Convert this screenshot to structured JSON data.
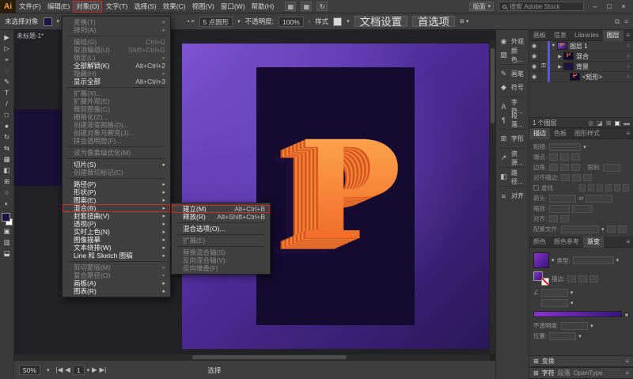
{
  "titlebar": {
    "logo": "Ai",
    "menus": [
      "文件(F)",
      "编辑(E)",
      "对象(O)",
      "文字(T)",
      "选择(S)",
      "效果(C)",
      "视图(V)",
      "窗口(W)",
      "帮助(H)"
    ],
    "active_menu_index": 2,
    "icons": [
      {
        "name": "arrange-documents-icon",
        "glyph": "▦"
      },
      {
        "name": "workspace-switcher-icon",
        "glyph": "▦"
      },
      {
        "name": "share-icon",
        "glyph": "↻"
      }
    ],
    "workspace_label": "版面",
    "search_placeholder": "搜索 Adobe Stock",
    "window_controls": {
      "minimize": "–",
      "maximize": "□",
      "close": "×"
    }
  },
  "control_bar": {
    "no_selection_label": "未选择对象",
    "brush_value": "5 点圆形",
    "opacity_label": "不透明度:",
    "opacity_value": "100%",
    "style_label": "样式",
    "document_setup_label": "文档设置",
    "preferences_label": "首选项"
  },
  "document_tab": "未标题-1*",
  "object_menu": {
    "items": [
      {
        "label": "变换(T)",
        "arrow": true,
        "enabled": false
      },
      {
        "label": "排列(A)",
        "arrow": true,
        "enabled": false
      },
      {
        "type": "sep"
      },
      {
        "label": "编组(G)",
        "shortcut": "Ctrl+G",
        "enabled": false
      },
      {
        "label": "取消编组(U)",
        "shortcut": "Shift+Ctrl+G",
        "enabled": false
      },
      {
        "label": "锁定(L)",
        "arrow": true,
        "enabled": false
      },
      {
        "label": "全部解锁(K)",
        "shortcut": "Alt+Ctrl+2",
        "enabled": true
      },
      {
        "label": "隐藏(H)",
        "arrow": true,
        "enabled": false
      },
      {
        "label": "显示全部",
        "shortcut": "Alt+Ctrl+3",
        "enabled": true
      },
      {
        "type": "sep"
      },
      {
        "label": "扩展(X)...",
        "enabled": false
      },
      {
        "label": "扩展外观(E)",
        "enabled": false
      },
      {
        "label": "裁剪图像(C)",
        "enabled": false
      },
      {
        "label": "栅格化(Z)...",
        "enabled": false
      },
      {
        "label": "创建渐变网格(D)...",
        "enabled": false
      },
      {
        "label": "创建对象马赛克(J)...",
        "enabled": false
      },
      {
        "label": "拼合透明度(F)...",
        "enabled": false
      },
      {
        "type": "sep"
      },
      {
        "label": "设为像素级优化(M)",
        "enabled": false
      },
      {
        "type": "sep"
      },
      {
        "label": "切片(S)",
        "arrow": true,
        "enabled": true
      },
      {
        "label": "创建裁切标记(C)",
        "enabled": false
      },
      {
        "type": "sep"
      },
      {
        "label": "路径(P)",
        "arrow": true,
        "enabled": true
      },
      {
        "label": "形状(P)",
        "arrow": true,
        "enabled": true
      },
      {
        "label": "图案(E)",
        "arrow": true,
        "enabled": true
      },
      {
        "label": "混合(B)",
        "arrow": true,
        "enabled": true,
        "annotated": true
      },
      {
        "label": "封套扭曲(V)",
        "arrow": true,
        "enabled": true
      },
      {
        "label": "透视(P)",
        "arrow": true,
        "enabled": true
      },
      {
        "label": "实时上色(N)",
        "arrow": true,
        "enabled": true
      },
      {
        "label": "图像描摹",
        "arrow": true,
        "enabled": true
      },
      {
        "label": "文本绕排(W)",
        "arrow": true,
        "enabled": true
      },
      {
        "label": "Line 和 Sketch 图稿",
        "arrow": true,
        "enabled": true
      },
      {
        "type": "sep"
      },
      {
        "label": "剪切蒙版(M)",
        "arrow": true,
        "enabled": false
      },
      {
        "label": "复合路径(O)",
        "arrow": true,
        "enabled": false
      },
      {
        "label": "画板(A)",
        "arrow": true,
        "enabled": true
      },
      {
        "label": "图表(R)",
        "arrow": true,
        "enabled": true
      }
    ]
  },
  "blend_submenu": {
    "items": [
      {
        "label": "建立(M)",
        "shortcut": "Alt+Ctrl+B",
        "enabled": true,
        "annotated": true
      },
      {
        "label": "释放(R)",
        "shortcut": "Alt+Shift+Ctrl+B",
        "enabled": true
      },
      {
        "type": "sep"
      },
      {
        "label": "混合选项(O)...",
        "enabled": true
      },
      {
        "type": "sep"
      },
      {
        "label": "扩展(E)",
        "enabled": false
      },
      {
        "type": "sep"
      },
      {
        "label": "替换混合轴(S)",
        "enabled": false
      },
      {
        "label": "反向混合轴(V)",
        "enabled": false
      },
      {
        "label": "反向堆叠(F)",
        "enabled": false
      }
    ]
  },
  "toolbar": {
    "tools": [
      {
        "name": "selection-tool",
        "glyph": "▶"
      },
      {
        "name": "direct-selection-tool",
        "glyph": "▷"
      },
      {
        "name": "magic-wand-tool",
        "glyph": "⌖"
      },
      {
        "name": "lasso-tool",
        "glyph": "◌"
      },
      {
        "name": "pen-tool",
        "glyph": "✎"
      },
      {
        "name": "type-tool",
        "glyph": "T"
      },
      {
        "name": "line-segment-tool",
        "glyph": "/"
      },
      {
        "name": "rectangle-tool",
        "glyph": "□"
      },
      {
        "name": "paintbrush-tool",
        "glyph": "●"
      },
      {
        "name": "rotate-tool",
        "glyph": "↻"
      },
      {
        "name": "width-tool",
        "glyph": "⇆"
      },
      {
        "name": "mesh-tool",
        "glyph": "▦"
      },
      {
        "name": "gradient-tool",
        "glyph": "◧"
      },
      {
        "name": "blend-tool",
        "glyph": "⊞"
      },
      {
        "name": "hand-tool",
        "glyph": "○"
      },
      {
        "name": "zoom-tool",
        "glyph": "◐"
      }
    ],
    "fill_color": "#1e1444",
    "mode_icons": [
      {
        "name": "draw-normal-icon",
        "glyph": "▣"
      },
      {
        "name": "draw-behind-icon",
        "glyph": "▥"
      },
      {
        "name": "screen-mode-icon",
        "glyph": "⬓"
      }
    ]
  },
  "canvas": {
    "letter": "P",
    "colors": {
      "artboard_light": "#7f54d6",
      "artboard_dark": "#2a1758",
      "poster": "#150b30",
      "letter_top": "#ffb254",
      "letter_bottom": "#ef5a1e",
      "letter_side_a": "#d4541c",
      "letter_side_b": "#f08438",
      "letter_shadow": "#1a0d38",
      "annotation_red": "#c9302c"
    }
  },
  "status_bar": {
    "zoom_value": "50%",
    "first_label": "|◀",
    "prev_label": "◀",
    "artboard_value": "1",
    "next_label": "▶",
    "last_label": "▶|",
    "tool_label": "选择"
  },
  "icon_strip": [
    {
      "name": "appearance-icon",
      "glyph": "◉",
      "label": "外观",
      "sep_after": false
    },
    {
      "name": "color-guide-icon",
      "glyph": "▧",
      "label": "颜色...",
      "sep_after": true
    },
    {
      "name": "brushes-icon",
      "glyph": "✎",
      "label": "画笔",
      "sep_after": false
    },
    {
      "name": "symbols-icon",
      "glyph": "◆",
      "label": "符号",
      "sep_after": true
    },
    {
      "name": "character-styles-icon",
      "glyph": "A",
      "label": "字符...",
      "sep_after": false
    },
    {
      "name": "paragraph-styles-icon",
      "glyph": "¶",
      "label": "段落...",
      "sep_after": true
    },
    {
      "name": "glyphs-icon",
      "glyph": "⊞",
      "label": "字形",
      "sep_after": true
    },
    {
      "name": "asset-export-icon",
      "glyph": "↗",
      "label": "资源...",
      "sep_after": true
    },
    {
      "name": "pathfinder-icon",
      "glyph": "◧",
      "label": "路径...",
      "sep_after": true
    },
    {
      "name": "align-icon",
      "glyph": "≡",
      "label": "对齐",
      "sep_after": false
    }
  ],
  "layers_panel": {
    "tabs": [
      "画板",
      "信息",
      "Libraries",
      "图层"
    ],
    "active_tab": "图层",
    "rows": [
      {
        "name": "图层 1",
        "indent": 0,
        "disclosure": "expanded",
        "eye": true,
        "lock": false,
        "thumb": "artboard"
      },
      {
        "name": "混合",
        "indent": 1,
        "disclosure": "collapsed",
        "eye": true,
        "lock": false,
        "thumb": "blend"
      },
      {
        "name": "背景",
        "indent": 1,
        "disclosure": "collapsed",
        "eye": true,
        "lock": true,
        "thumb": "background"
      },
      {
        "name": "<矩形>",
        "indent": 2,
        "disclosure": "none",
        "eye": true,
        "lock": false,
        "thumb": "blend"
      }
    ],
    "footer_label": "1 个图层",
    "footer_icons": [
      {
        "name": "locate-object-icon",
        "glyph": "◎",
        "hot": false
      },
      {
        "name": "make-clipping-mask-icon",
        "glyph": "◪",
        "hot": false
      },
      {
        "name": "new-sublayer-icon",
        "glyph": "⊞",
        "hot": false
      },
      {
        "name": "new-layer-icon",
        "glyph": "▣",
        "hot": true
      },
      {
        "name": "delete-selection-icon",
        "glyph": "▬",
        "hot": false
      }
    ]
  },
  "stroke_panel": {
    "tabs": [
      "描边",
      "色板",
      "图形样式"
    ],
    "active_tab": "描边",
    "weight_label": "粗细:",
    "cap_label": "端点:",
    "corner_label": "边角:",
    "limit_label": "限制:",
    "align_stroke_label": "对齐描边:",
    "dashed_label": "虚线",
    "arrows_label": "箭头:",
    "scale_label": "缩放:",
    "align_label": "对齐:",
    "profile_label": "配置文件:"
  },
  "gradient_panel": {
    "tabs": [
      "颜色",
      "颜色参考",
      "渐变"
    ],
    "active_tab": "渐变",
    "type_label": "类型:",
    "stroke_label": "描边:",
    "angle_label": "∠",
    "opacity_label": "不透明度:",
    "location_label": "位置:",
    "bar_start": "#8a33cc",
    "bar_end": "#34177a"
  },
  "transform_panel": {
    "label": "变换"
  },
  "type_panels": {
    "tabs": [
      "字符",
      "段落",
      "OpenType"
    ]
  }
}
